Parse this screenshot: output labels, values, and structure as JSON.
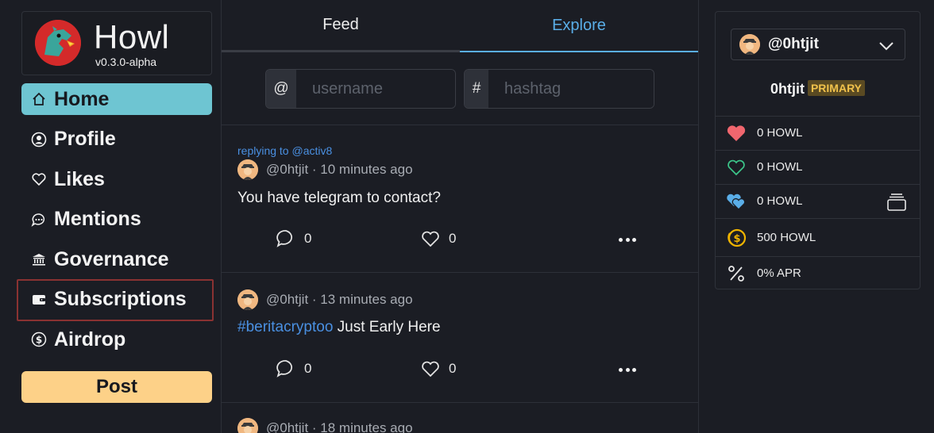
{
  "brand": {
    "name": "Howl",
    "version": "v0.3.0-alpha"
  },
  "nav": {
    "items": [
      {
        "label": "Home",
        "icon": "home-icon",
        "active": true
      },
      {
        "label": "Profile",
        "icon": "user-circle-icon"
      },
      {
        "label": "Likes",
        "icon": "heart-outline-icon"
      },
      {
        "label": "Mentions",
        "icon": "chat-dots-icon"
      },
      {
        "label": "Governance",
        "icon": "bank-icon"
      },
      {
        "label": "Subscriptions",
        "icon": "wallet-icon"
      },
      {
        "label": "Airdrop",
        "icon": "coin-icon"
      }
    ],
    "post_label": "Post"
  },
  "tabs": {
    "feed": "Feed",
    "explore": "Explore"
  },
  "search": {
    "user_prefix": "@",
    "user_placeholder": "username",
    "tag_prefix": "#",
    "tag_placeholder": "hashtag"
  },
  "posts": [
    {
      "reply_to": "replying to @activ8",
      "author": "@0htjit",
      "time": "10 minutes ago",
      "hashtag": "",
      "text": "You have telegram to contact?",
      "comments": "0",
      "likes": "0"
    },
    {
      "author": "@0htjit",
      "time": "13 minutes ago",
      "hashtag": "#beritacryptoo",
      "text": " Just Early Here",
      "comments": "0",
      "likes": "0"
    },
    {
      "author": "@0htjit",
      "time": "18 minutes ago"
    }
  ],
  "account": {
    "selected": "@0htjit",
    "name": "0htjit",
    "badge": "PRIMARY",
    "rows": [
      {
        "icon": "heart-filled-red-icon",
        "text": "0 HOWL"
      },
      {
        "icon": "heart-outline-green-icon",
        "text": "0 HOWL"
      },
      {
        "icon": "hearts-blue-icon",
        "text": "0 HOWL"
      },
      {
        "icon": "coins-gold-icon",
        "text": "500 HOWL"
      },
      {
        "icon": "percent-icon",
        "text": "0% APR"
      }
    ]
  },
  "colors": {
    "accent": "#6ec5d2",
    "post": "#fdd188",
    "link": "#4a90e2",
    "background": "#1b1d24"
  }
}
